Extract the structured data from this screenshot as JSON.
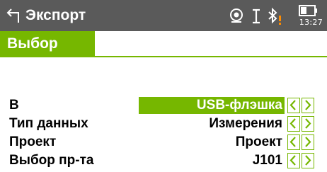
{
  "titlebar": {
    "title": "Экспорт",
    "time": "13:27"
  },
  "tabs": [
    {
      "label": "Выбор",
      "active": true
    }
  ],
  "rows": [
    {
      "label": "В",
      "value": "USB-флэшка",
      "selected": true
    },
    {
      "label": "Тип данных",
      "value": "Измерения",
      "selected": false
    },
    {
      "label": "Проект",
      "value": "Проект",
      "selected": false
    },
    {
      "label": "Выбор пр-та",
      "value": "J101",
      "selected": false
    }
  ],
  "colors": {
    "titlebar_bg": "#5a5a5a",
    "accent_green": "#76b700",
    "warning_orange": "#ff8c00",
    "text": "#000000"
  },
  "icons": {
    "back": "back-arrow-icon",
    "gps": "gps-satellite-icon",
    "cursor": "text-cursor-icon",
    "bluetooth": "bluetooth-warning-icon",
    "battery": "battery-icon",
    "arrow_left": "arrow-left-icon",
    "arrow_right": "arrow-right-icon"
  }
}
